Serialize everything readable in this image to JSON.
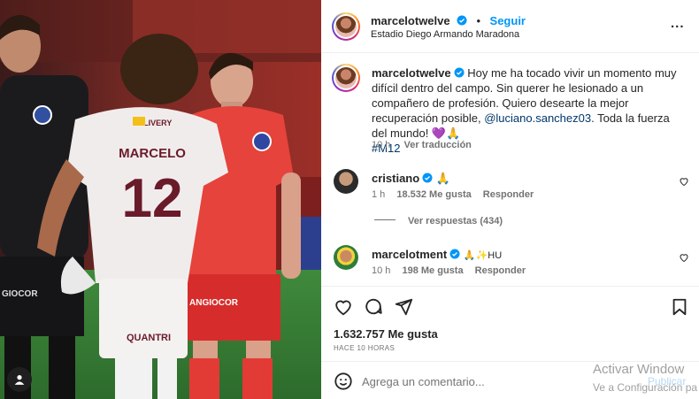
{
  "post": {
    "author": "marcelotwelve",
    "follow_label": "Seguir",
    "separator": "•",
    "location": "Estadio Diego Armando Maradona",
    "more_label": "...",
    "caption_text": "Hoy me ha tocado vivir un momento muy difícil dentro del campo. Sin querer he lesionado a un compañero de profesión. Quiero desearte la mejor recuperación posible,",
    "caption_mention": "@luciano.sanchez03",
    "caption_tail": ". Toda la fuerza del mundo! 💜🙏",
    "caption_hashtag": "#M12",
    "caption_time": "10 h",
    "translate_label": "Ver traducción"
  },
  "photo": {
    "jersey_name": "MARCELO",
    "jersey_number": "12",
    "sponsor": "DELIVERY",
    "shorts_brand": "QUANTRI",
    "red_shorts_sponsor": "ANGIOCOR",
    "black_shorts_sponsor": "GIOCOR"
  },
  "comments": [
    {
      "user": "cristiano",
      "text": "🙏",
      "time": "1 h",
      "likes": "18.532 Me gusta",
      "reply": "Responder",
      "view_replies": "Ver respuestas (434)"
    },
    {
      "user": "marcelotment",
      "text": "🙏✨HU",
      "time": "10 h",
      "likes": "198 Me gusta",
      "reply": "Responder"
    }
  ],
  "stats": {
    "likes": "1.632.757 Me gusta",
    "posted": "HACE 10 HORAS"
  },
  "comment_input": {
    "placeholder": "Agrega un comentario...",
    "publish_label": "Publicar"
  },
  "watermark": {
    "line1": "Activar Window",
    "line2": "Ve a Configuración pa"
  },
  "colors": {
    "accent": "#0095f6",
    "link": "#00376b",
    "muted": "#737373",
    "text": "#262626"
  }
}
